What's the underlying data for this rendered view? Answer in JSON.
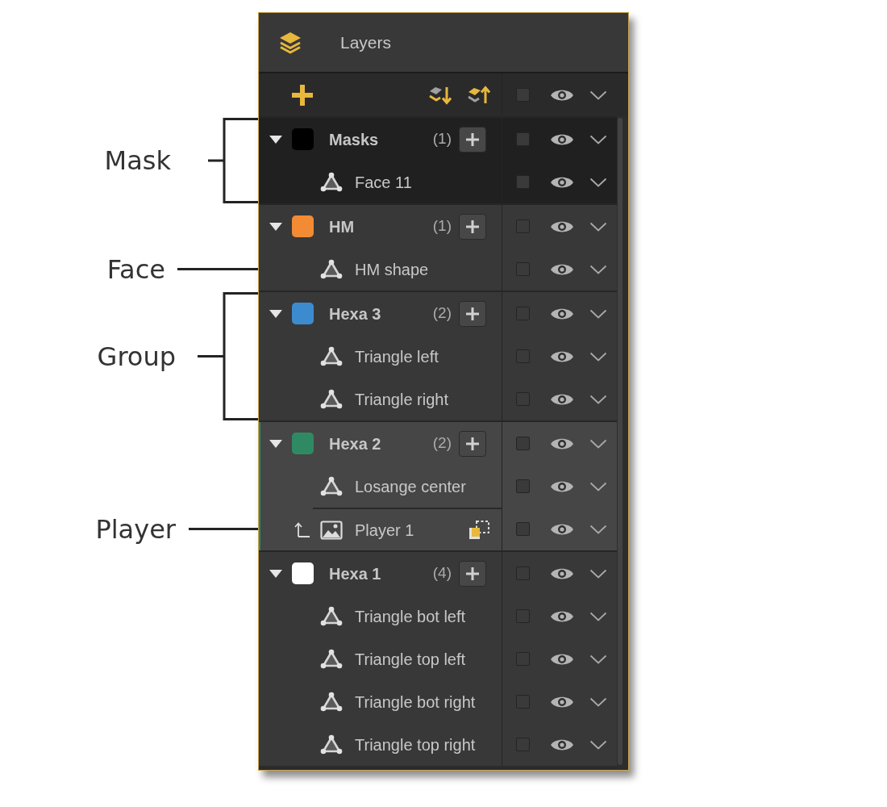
{
  "panel": {
    "title": "Layers"
  },
  "toolbar": {
    "checked": false,
    "visible": true
  },
  "layers": [
    {
      "kind": "mask",
      "name": "Masks",
      "count": "(1)",
      "color": "#000000",
      "expanded": true,
      "selected": false,
      "checked": false,
      "visible": true,
      "children": [
        {
          "kind": "face",
          "name": "Face 11",
          "selected": false,
          "checked": false,
          "visible": true
        }
      ]
    },
    {
      "kind": "group",
      "name": "HM",
      "count": "(1)",
      "color": "#f28b33",
      "expanded": true,
      "selected": false,
      "checked": false,
      "visible": true,
      "children": [
        {
          "kind": "face",
          "name": "HM shape",
          "selected": false,
          "checked": false,
          "visible": true
        }
      ]
    },
    {
      "kind": "group",
      "name": "Hexa 3",
      "count": "(2)",
      "color": "#3d8bcf",
      "expanded": true,
      "selected": false,
      "checked": false,
      "visible": true,
      "children": [
        {
          "kind": "face",
          "name": "Triangle left",
          "selected": false,
          "checked": false,
          "visible": true
        },
        {
          "kind": "face",
          "name": "Triangle right",
          "selected": false,
          "checked": false,
          "visible": true
        }
      ]
    },
    {
      "kind": "group",
      "name": "Hexa 2",
      "count": "(2)",
      "color": "#2f8a64",
      "expanded": true,
      "selected": true,
      "checked": false,
      "visible": true,
      "children": [
        {
          "kind": "face",
          "name": "Losange center",
          "selected": false,
          "checked": false,
          "visible": true
        },
        {
          "kind": "image",
          "name": "Player 1",
          "selected": false,
          "checked": false,
          "visible": true
        }
      ]
    },
    {
      "kind": "group",
      "name": "Hexa 1",
      "count": "(4)",
      "color": "#ffffff",
      "expanded": true,
      "selected": false,
      "checked": false,
      "visible": true,
      "children": [
        {
          "kind": "face",
          "name": "Triangle bot left",
          "selected": false,
          "checked": false,
          "visible": true
        },
        {
          "kind": "face",
          "name": "Triangle top left",
          "selected": false,
          "checked": false,
          "visible": true
        },
        {
          "kind": "face",
          "name": "Triangle bot right",
          "selected": false,
          "checked": false,
          "visible": true
        },
        {
          "kind": "face",
          "name": "Triangle top right",
          "selected": false,
          "checked": false,
          "visible": true
        }
      ]
    }
  ],
  "annotations": [
    {
      "kind": "bracket",
      "label": "Mask"
    },
    {
      "kind": "line",
      "label": "Face"
    },
    {
      "kind": "bracket",
      "label": "Group"
    },
    {
      "kind": "line",
      "label": "Player"
    }
  ]
}
